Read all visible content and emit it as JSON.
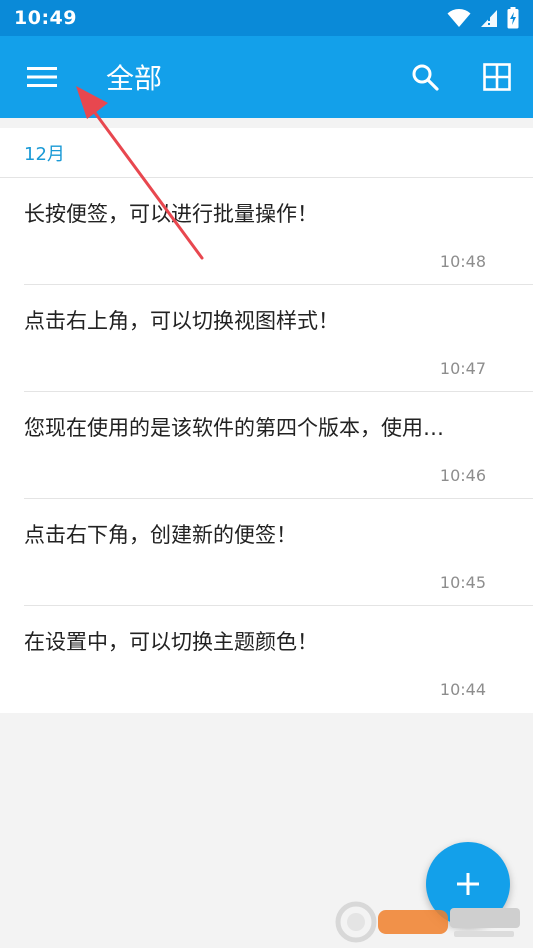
{
  "status_bar": {
    "time": "10:49",
    "icons": [
      "wifi-icon",
      "signal-icon",
      "battery-charging-icon"
    ]
  },
  "app_bar": {
    "title": "全部",
    "left_icon": "hamburger-menu-icon",
    "right_icons": [
      "search-icon",
      "grid-view-icon"
    ]
  },
  "list": {
    "month_header": "12月",
    "notes": [
      {
        "text": "长按便签，可以进行批量操作！",
        "time": "10:48"
      },
      {
        "text": "点击右上角，可以切换视图样式！",
        "time": "10:47"
      },
      {
        "text": "您现在使用的是该软件的第四个版本，使用…",
        "time": "10:46"
      },
      {
        "text": "点击右下角，创建新的便签！",
        "time": "10:45"
      },
      {
        "text": "在设置中，可以切换主题颜色！",
        "time": "10:44"
      }
    ]
  },
  "fab": {
    "icon": "plus-icon"
  },
  "colors": {
    "status_bar": "#0a8ad8",
    "app_bar": "#13a0ea",
    "month_text": "#1a9ad6",
    "annotation_arrow": "#e8474f"
  }
}
